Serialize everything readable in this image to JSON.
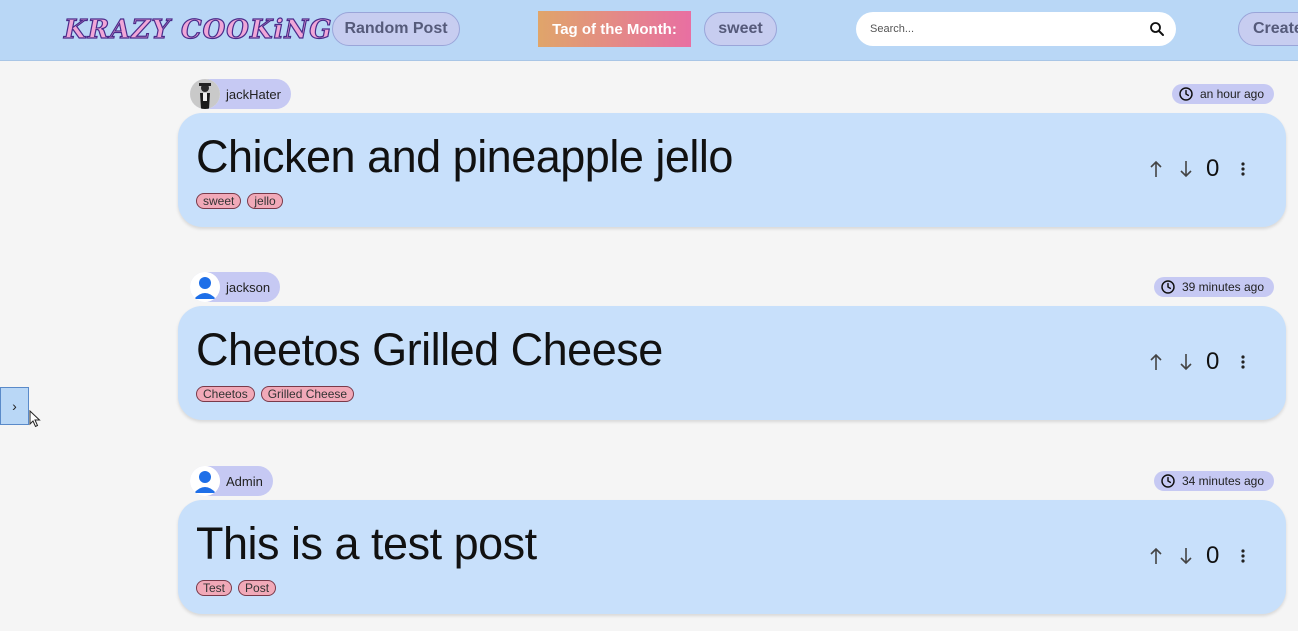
{
  "header": {
    "logo": "KRAZY COOKiNG",
    "random_label": "Random Post",
    "tag_month_label": "Tag of the Month:",
    "tag_month_value": "sweet",
    "search_placeholder": "Search...",
    "create_label": "Create"
  },
  "sidebar": {
    "toggle_label": "›"
  },
  "posts": [
    {
      "author": "jackHater",
      "avatar": "photo-avatar",
      "time": "an hour ago",
      "title": "Chicken and pineapple jello",
      "tags": [
        "sweet",
        "jello"
      ],
      "score": "0"
    },
    {
      "author": "jackson",
      "avatar": "person-icon",
      "time": "39 minutes ago",
      "title": "Cheetos Grilled Cheese",
      "tags": [
        "Cheetos",
        "Grilled Cheese"
      ],
      "score": "0"
    },
    {
      "author": "Admin",
      "avatar": "person-icon",
      "time": "34 minutes ago",
      "title": "This is a test post",
      "tags": [
        "Test",
        "Post"
      ],
      "score": "0"
    }
  ],
  "colors": {
    "header_bg": "#b9d7f6",
    "card_bg": "#c8e0fb",
    "pill_bg": "#c6c9f3",
    "tag_bg": "#f1a9b8",
    "avatar_blue": "#1e6fe8"
  }
}
